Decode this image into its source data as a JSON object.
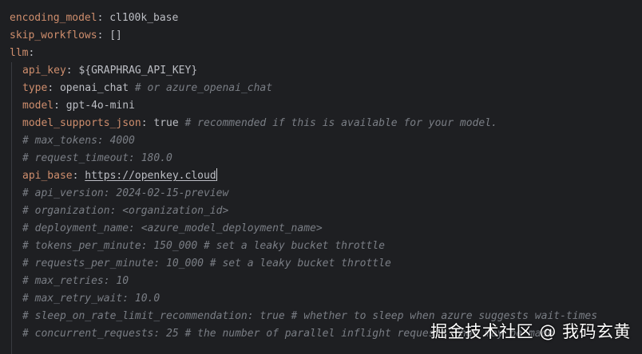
{
  "theme": {
    "background": "#1e1f22",
    "key_color": "#cf8e6d",
    "text_color": "#bcbec4",
    "comment_color": "#7a7e85"
  },
  "lines": {
    "l1": {
      "key": "encoding_model",
      "value": "cl100k_base"
    },
    "l2": {
      "key": "skip_workflows",
      "value": "[]"
    },
    "l3": {
      "key": "llm"
    },
    "l4": {
      "key": "api_key",
      "value": "${GRAPHRAG_API_KEY}"
    },
    "l5": {
      "key": "type",
      "value": "openai_chat",
      "comment": "# or azure_openai_chat"
    },
    "l6": {
      "key": "model",
      "value": "gpt-4o-mini"
    },
    "l7": {
      "key": "model_supports_json",
      "value": "true",
      "comment": "# recommended if this is available for your model."
    },
    "l8": {
      "comment": "# max_tokens: 4000"
    },
    "l9": {
      "comment": "# request_timeout: 180.0"
    },
    "l10": {
      "key": "api_base",
      "value": "https://openkey.cloud"
    },
    "l11": {
      "comment": "# api_version: 2024-02-15-preview"
    },
    "l12": {
      "comment": "# organization: <organization_id>"
    },
    "l13": {
      "comment": "# deployment_name: <azure_model_deployment_name>"
    },
    "l14": {
      "comment": "# tokens_per_minute: 150_000 # set a leaky bucket throttle"
    },
    "l15": {
      "comment": "# requests_per_minute: 10_000 # set a leaky bucket throttle"
    },
    "l16": {
      "comment": "# max_retries: 10"
    },
    "l17": {
      "comment": "# max_retry_wait: 10.0"
    },
    "l18": {
      "comment": "# sleep_on_rate_limit_recommendation: true # whether to sleep when azure suggests wait-times"
    },
    "l19": {
      "comment": "# concurrent_requests: 25 # the number of parallel inflight requests that may be made"
    }
  },
  "watermark": "掘金技术社区 @ 我码玄黄"
}
